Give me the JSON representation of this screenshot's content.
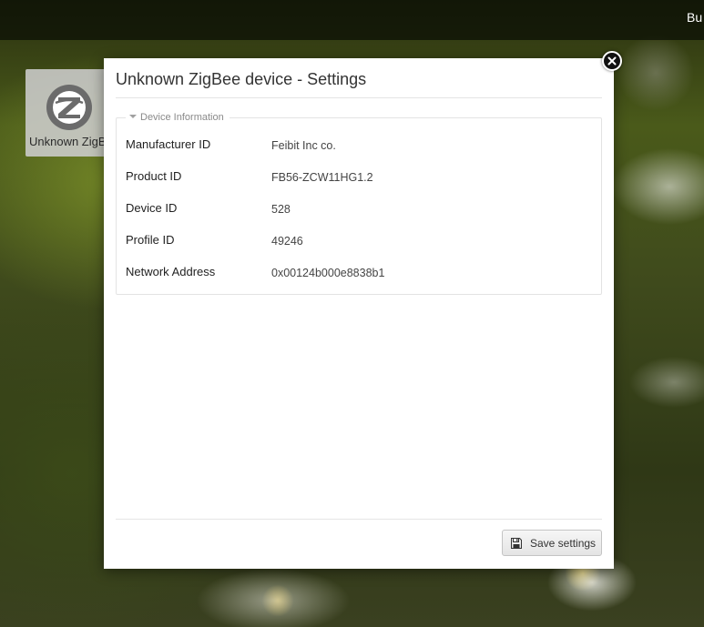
{
  "topbar": {
    "text": "Bu"
  },
  "device_tile": {
    "label": "Unknown ZigBee device",
    "icon": "zigbee-logo-icon"
  },
  "dialog": {
    "title": "Unknown ZigBee device - Settings",
    "close_icon": "close-icon",
    "section": {
      "legend": "Device Information",
      "rows": [
        {
          "label": "Manufacturer ID",
          "value": "Feibit Inc co."
        },
        {
          "label": "Product ID",
          "value": "FB56-ZCW11HG1.2"
        },
        {
          "label": "Device ID",
          "value": "528"
        },
        {
          "label": "Profile ID",
          "value": "49246"
        },
        {
          "label": "Network Address",
          "value": "0x00124b000e8838b1"
        }
      ]
    },
    "save_button": {
      "label": "Save settings",
      "icon": "floppy-disk-icon"
    }
  }
}
